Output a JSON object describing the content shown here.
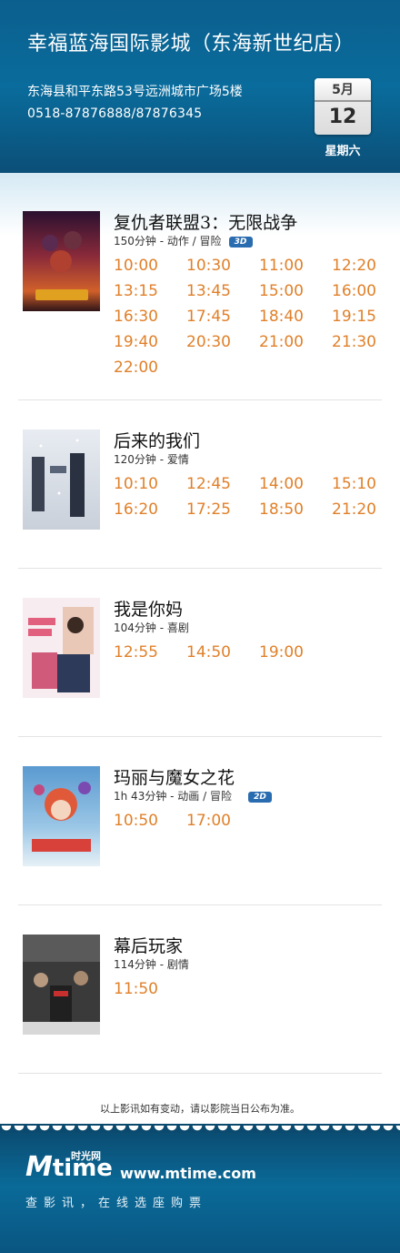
{
  "header": {
    "title": "幸福蓝海国际影城（东海新世纪店）",
    "address": "东海县和平东路53号远洲城市广场5楼",
    "phone": "0518-87876888/87876345",
    "month": "5月",
    "day": "12",
    "weekday": "星期六"
  },
  "movies": [
    {
      "title": "复仇者联盟3：无限战争",
      "meta": "150分钟 - 动作 / 冒险",
      "format": "3D",
      "times": [
        "10:00",
        "10:30",
        "11:00",
        "12:20",
        "13:15",
        "13:45",
        "15:00",
        "16:00",
        "16:30",
        "17:45",
        "18:40",
        "19:15",
        "19:40",
        "20:30",
        "21:00",
        "21:30",
        "22:00"
      ]
    },
    {
      "title": "后来的我们",
      "meta": "120分钟 - 爱情",
      "format": "",
      "times": [
        "10:10",
        "12:45",
        "14:00",
        "15:10",
        "16:20",
        "17:25",
        "18:50",
        "21:20"
      ]
    },
    {
      "title": "我是你妈",
      "meta": "104分钟 - 喜剧",
      "format": "",
      "times": [
        "12:55",
        "14:50",
        "19:00"
      ]
    },
    {
      "title": "玛丽与魔女之花",
      "meta": "1h 43分钟 - 动画 / 冒险",
      "format": "2D",
      "times": [
        "10:50",
        "17:00"
      ]
    },
    {
      "title": "幕后玩家",
      "meta": "114分钟 - 剧情",
      "format": "",
      "times": [
        "11:50"
      ]
    }
  ],
  "notice": "以上影讯如有变动，请以影院当日公布为准。",
  "footer": {
    "logo_m": "M",
    "logo_word": "time",
    "logo_cn": "时光网",
    "url": "www.mtime.com",
    "slogan": "查影讯，在线选座购票"
  },
  "colors": {
    "header_blue": "#0a6c9c",
    "time_orange": "#e0802a",
    "badge_blue": "#2a6cb0"
  }
}
